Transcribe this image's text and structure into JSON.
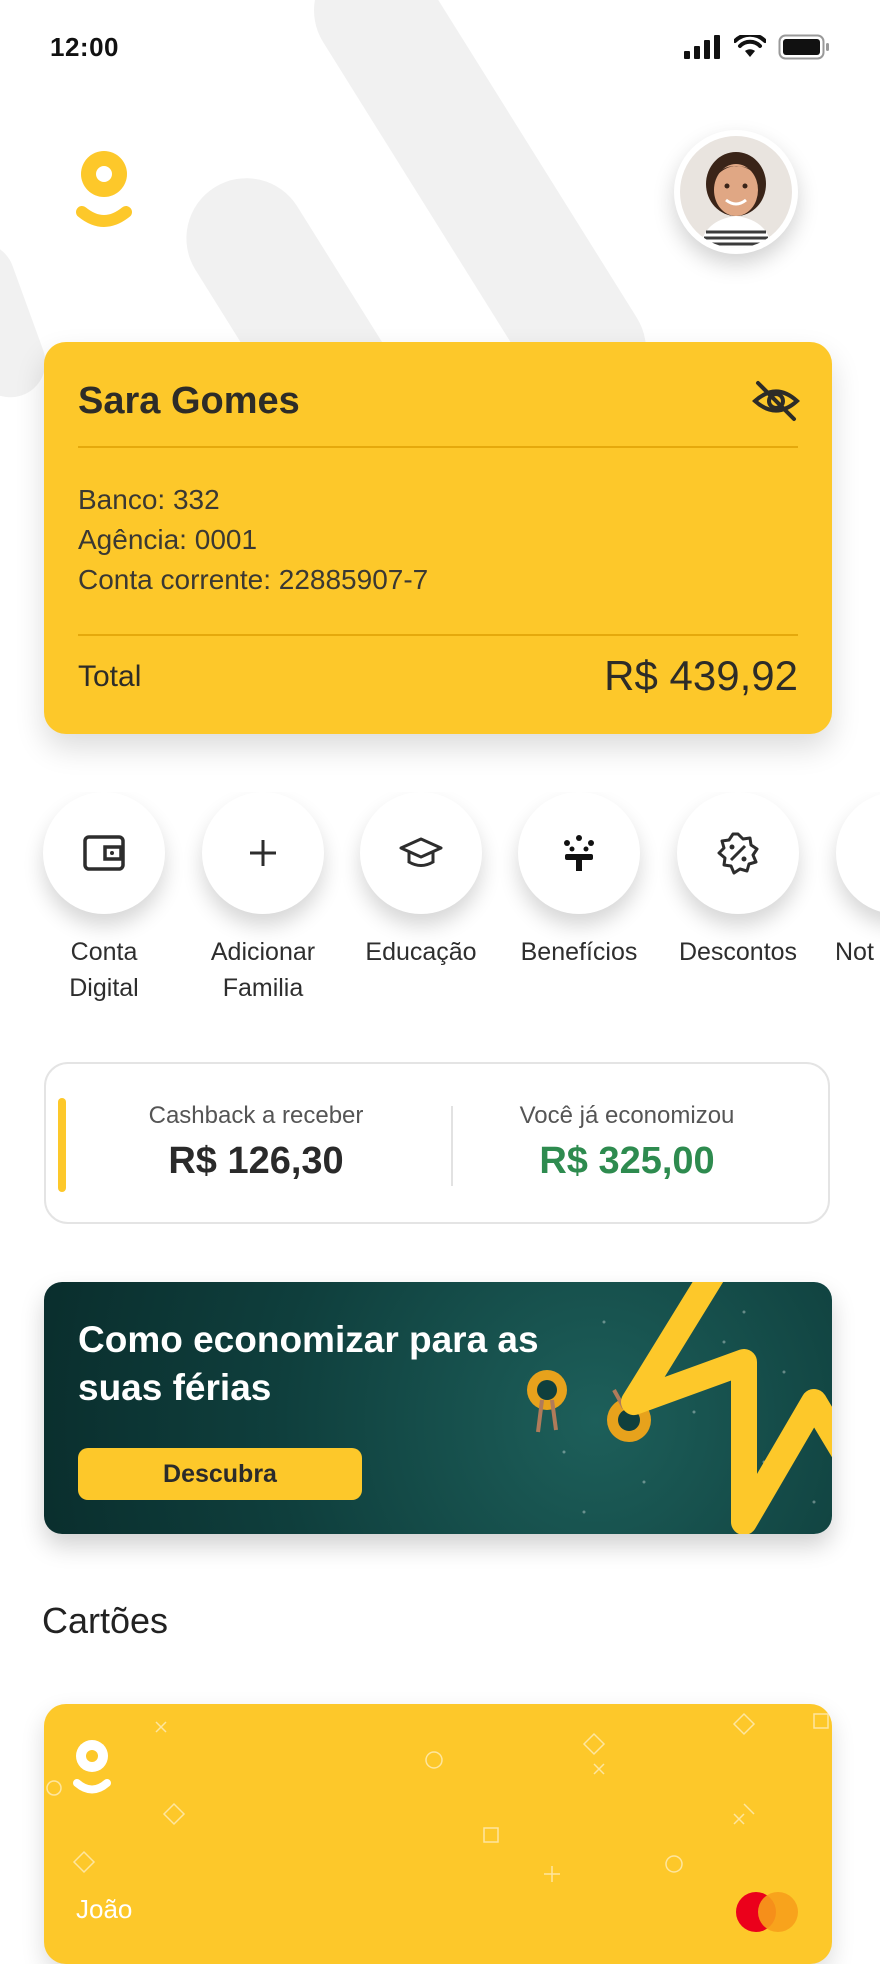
{
  "status_bar": {
    "time": "12:00"
  },
  "account": {
    "name": "Sara Gomes",
    "bank": "Banco: 332",
    "agency": "Agência: 0001",
    "account_number": "Conta corrente: 22885907-7",
    "total_label": "Total",
    "total_value": "R$ 439,92"
  },
  "actions": [
    {
      "line1": "Conta",
      "line2": "Digital",
      "icon": "wallet-icon"
    },
    {
      "line1": "Adicionar",
      "line2": "Familia",
      "icon": "plus-icon"
    },
    {
      "line1": "Educação",
      "line2": "",
      "icon": "graduation-cap-icon"
    },
    {
      "line1": "Benefícios",
      "line2": "",
      "icon": "benefits-icon"
    },
    {
      "line1": "Descontos",
      "line2": "",
      "icon": "discount-badge-icon"
    },
    {
      "line1": "Not",
      "line2": "",
      "icon": "notification-icon"
    }
  ],
  "cashback": {
    "to_receive_label": "Cashback a receber",
    "to_receive_value": "R$ 126,30",
    "saved_label": "Você já economizou",
    "saved_value": "R$ 325,00"
  },
  "promo": {
    "title": "Como economizar para as suas férias",
    "button": "Descubra"
  },
  "cards_section": {
    "title": "Cartões",
    "holder_partial": "João"
  },
  "colors": {
    "brand_yellow": "#fdc82a",
    "green": "#2e8b4f",
    "dark_text": "#2d2c28"
  }
}
